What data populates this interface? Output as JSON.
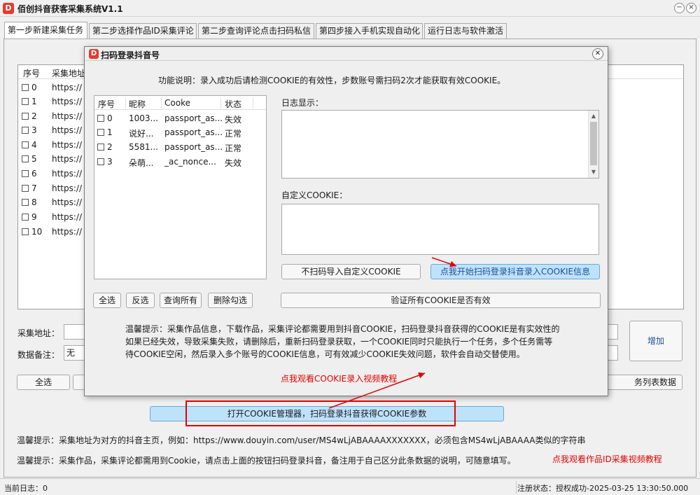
{
  "app": {
    "title": "佰创抖音获客采集系统V1.1",
    "logo_letter": "D"
  },
  "window_buttons": [
    "−",
    "×"
  ],
  "tabs": [
    {
      "label": "第一步新建采集任务",
      "active": true
    },
    {
      "label": "第二步选择作品ID采集评论",
      "active": false
    },
    {
      "label": "第二步查询评论点击扫码私信",
      "active": false
    },
    {
      "label": "第四步接入手机实现自动化",
      "active": false
    },
    {
      "label": "运行日志与软件激活",
      "active": false
    }
  ],
  "main_list": {
    "columns": [
      "序号",
      "采集地址"
    ],
    "rows": [
      {
        "num": "0",
        "url": "https://"
      },
      {
        "num": "1",
        "url": "https://"
      },
      {
        "num": "2",
        "url": "https://"
      },
      {
        "num": "3",
        "url": "https://"
      },
      {
        "num": "4",
        "url": "https://"
      },
      {
        "num": "5",
        "url": "https://"
      },
      {
        "num": "6",
        "url": "https://"
      },
      {
        "num": "7",
        "url": "https://"
      },
      {
        "num": "8",
        "url": "https://"
      },
      {
        "num": "9",
        "url": "https://"
      },
      {
        "num": "10",
        "url": "https://"
      }
    ]
  },
  "form": {
    "address_label": "采集地址：",
    "address_value": "",
    "remark_label": "数据备注：",
    "remark_value": "无",
    "add_button": "增加",
    "select_all_button": "全选",
    "list_data_button": "务列表数据"
  },
  "cookie_manager_button": "打开COOKIE管理器，扫码登录抖音获得COOKIE参数",
  "tips": {
    "line1": "温馨提示：采集地址为对方的抖音主页，例如：https://www.douyin.com/user/MS4wLjABAAAAXXXXXXX，必须包含MS4wLjABAAAA类似的字符串",
    "line2": "温馨提示：采集作品，采集评论都需用到Cookie，请点击上面的按钮扫码登录抖音，备注用于自己区分此条数据的说明，可随意填写。",
    "video_link": "点我观看作品ID采集视频教程"
  },
  "status": {
    "log": "当前日志：0",
    "registration": "注册状态：授权成功-2025-03-25 13:30:50.000"
  },
  "modal": {
    "title": "扫码登录抖音号",
    "logo_letter": "D",
    "description": "功能说明：录入成功后请检测COOKIE的有效性，步数账号需扫码2次才能获取有效COOKIE。",
    "columns": [
      "序号",
      "昵称",
      "Cooke",
      "状态"
    ],
    "accounts": [
      {
        "num": "0",
        "nickname": "1003...",
        "cookie": "passport_as...",
        "status": "失效"
      },
      {
        "num": "1",
        "nickname": "说好...",
        "cookie": "passport_as...",
        "status": "正常"
      },
      {
        "num": "2",
        "nickname": "5581...",
        "cookie": "passport_as...",
        "status": "正常"
      },
      {
        "num": "3",
        "nickname": "朵萌...",
        "cookie": "_ac_nonce...",
        "status": "失效"
      }
    ],
    "log_label": "日志显示：",
    "log_value": "",
    "custom_cookie_label": "自定义COOKIE：",
    "custom_cookie_value": "",
    "buttons": {
      "import_custom": "不扫码导入自定义COOKIE",
      "scan_login": "点我开始扫码登录抖音录入COOKIE信息",
      "select_all": "全选",
      "invert": "反选",
      "query_all": "查询所有",
      "delete_checked": "删除勾选",
      "verify_all": "验证所有COOKIE是否有效"
    },
    "warm_tips": [
      "温馨提示：采集作品信息，下载作品，采集评论都需要用到抖音COOKIE，扫码登录抖音获得的COOKIE是有实效性的",
      "如果已经失效，导致采集失败，请删除后，重新扫码登录获取，一个COOKIE同时只能执行一个任务，多个任务需等",
      "待COOKIE空闲，然后录入多个账号的COOKIE信息，可有效减少COOKIE失效问题，软件会自动交替使用。"
    ],
    "video_link": "点我观看COOKIE录入视频教程"
  },
  "colors": {
    "accent_red": "#e30000",
    "logo_red": "#e43c2f",
    "highlight_blue": "#bfe2fb"
  }
}
